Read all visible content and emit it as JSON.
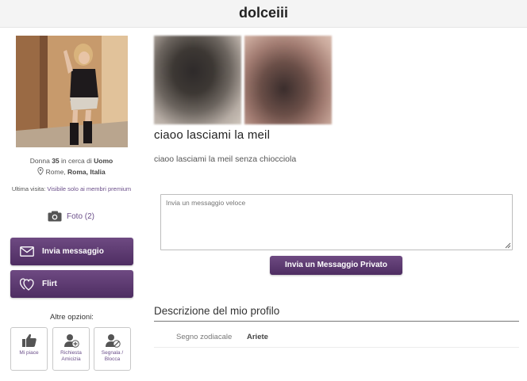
{
  "header": {
    "username": "dolceiii"
  },
  "profile": {
    "gender_age_prefix": "Donna ",
    "age": "35",
    "seeking_prefix": " in cerca di ",
    "seeking": "Uomo",
    "location_city": "Rome, ",
    "location_region": "Roma, ",
    "location_country": "Italia",
    "last_visit_label": "Ultima visita: ",
    "last_visit_value": "Visibile solo ai membri premium",
    "photos_label": "Foto (2)"
  },
  "actions": {
    "send_message": "Invia messaggio",
    "flirt": "Flirt",
    "more_options": "Altre opzioni:",
    "like": "Mi piace",
    "friend_request": "Richiesta Amicizia",
    "report_block": "Segnala / Blocca"
  },
  "about": {
    "headline": "ciaoo lasciami la meil",
    "text": "ciaoo lasciami la meil senza chiocciola"
  },
  "quick_message": {
    "placeholder": "Invia un messaggio veloce",
    "send_private": "Invia un Messaggio Privato"
  },
  "description": {
    "title": "Descrizione del mio profilo",
    "fields": [
      {
        "label": "Segno zodiacale",
        "value": "Ariete"
      }
    ]
  },
  "colors": {
    "accent": "#5e3a72",
    "link": "#6b4f8a"
  },
  "icons": {
    "location": "map-pin-icon",
    "camera": "camera-icon",
    "envelope": "envelope-icon",
    "flirt": "hearts-icon",
    "like": "thumbs-up-icon",
    "friend": "add-user-icon",
    "report": "user-block-icon"
  }
}
